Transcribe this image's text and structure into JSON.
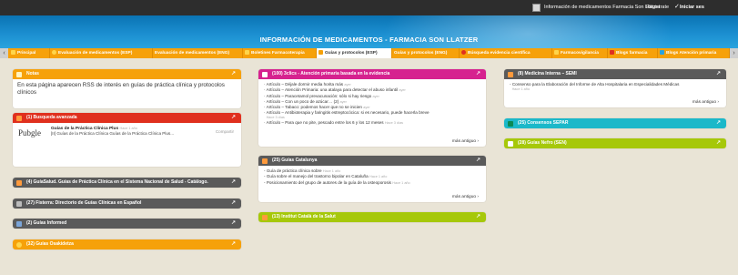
{
  "topbar": {
    "site_name": "Información de medicamentos Farmacia Son Llätzer",
    "register": "Registrate",
    "login": "Iniciar ses"
  },
  "header": {
    "title": "INFORMACIÓN DE MEDICAMENTOS - FARMACIA SON LLATZER"
  },
  "tabs": [
    {
      "label": "Principal",
      "icon_color": "#ffd54a"
    },
    {
      "label": "Evaluación de medicamentos (ESP)",
      "icon_color": "#ffd54a"
    },
    {
      "label": "Evaluación de medicamentos (ENG)",
      "icon_color": ""
    },
    {
      "label": "Boletines Farmacoterapia",
      "icon_color": "#ffd54a"
    },
    {
      "label": "Guías y protocolos (ESP)",
      "icon_color": "#f6a10a"
    },
    {
      "label": "Guías y protocolos (ENG)",
      "icon_color": ""
    },
    {
      "label": "Búsqueda evidencia científica",
      "icon_color": "#e0301e"
    },
    {
      "label": "Farmacovigilancia",
      "icon_color": "#ffd54a"
    },
    {
      "label": "Blogs farmacia",
      "icon_color": "#e0301e"
    },
    {
      "label": "Blogs Atención primaria",
      "icon_color": "#2aa3de"
    }
  ],
  "notes": {
    "title": "Notas",
    "color": "#f6a10a",
    "text": "En esta página aparecen RSS de interés en guías de práctica clínica y protocolos clínicos"
  },
  "busqueda": {
    "title": "(1) Busqueda avanzada",
    "color": "#e0301e",
    "logo": "Pubgle",
    "item_title": "Guías de la Práctica Clínica Plus",
    "item_ago": "Hace 1 año",
    "item_desc": "[II] Guías de la Práctica Clínica Guías de la Práctica Clínica Plus...",
    "compartir": "Compartir"
  },
  "left_widgets": [
    {
      "title": "(4) GuíaSalud. Guías de Práctica Clínica en el Sistema Nacional de Salud - Catálogo.",
      "color": "#5a5a5a"
    },
    {
      "title": "(27) Fisterra: Directorio de Guías Clínicas en Español",
      "color": "#5a5a5a"
    },
    {
      "title": "(2) Guías Informed",
      "color": "#5a5a5a"
    },
    {
      "title": "(32) Guías Osakidetza",
      "color": "#f6a10a"
    }
  ],
  "semfyc": {
    "title": "(100) 3clics - Atención primaria basada en la evidencia",
    "color": "#d6228f",
    "items": [
      {
        "text": "Artículo – Déjale dormir media horita más",
        "ago": "ayer"
      },
      {
        "text": "Artículo – Atención Primaria: una atalaya para detectar el abuso infantil",
        "ago": "ayer"
      },
      {
        "text": "Artículo – Paracetamol prevacunación: sólo si hay riesgo",
        "ago": "ayer"
      },
      {
        "text": "Artículo – Con un poco de azúcar… (2)",
        "ago": "ayer"
      },
      {
        "text": "Artículo – Tabaco: podemos hacer que no se inicien",
        "ago": "ayer"
      },
      {
        "text": "Artículo – Antibioterapia y faringitis estreptocócica: si es necesario, puede hacerla breve",
        "ago": "Hace 3 días"
      },
      {
        "text": "Artículo – Para que no pite, pescado entre los 6 y los 12 meses",
        "ago": "Hace 3 días"
      }
    ],
    "more": "más antiguo"
  },
  "catalunya": {
    "title": "(25) Guías Catalunya",
    "color": "#5a5a5a",
    "items": [
      {
        "text": "Guía de práctica clínica sobre",
        "ago": "Hace 1 año"
      },
      {
        "text": "Guía sobre el manejo del trastorno bipolar en Cataluña",
        "ago": "Hace 1 año"
      },
      {
        "text": "Posicionamiento del grupo de autores de la guía de la osteoporosis",
        "ago": "Hace 1 año"
      }
    ],
    "more": "más antiguo"
  },
  "ics": {
    "title": "(13) Institut Català de la Salut",
    "color": "#a6c80a"
  },
  "semi": {
    "title": "(8) Medicina Interna – SEMI",
    "color": "#5a5a5a",
    "items": [
      {
        "text": "Consenso para la Elaboración del Informe de Alta Hospitalaria en Especialidades Médicas",
        "ago": "Hace 1 año"
      }
    ],
    "more": "más antiguo"
  },
  "separ": {
    "title": "(25) Consensos SEPAR",
    "color": "#1bb8c9"
  },
  "nefro": {
    "title": "(28) Guías Nefro (SEN)",
    "color": "#a6c80a"
  },
  "more_arrow": "›",
  "menu_arrow": "↗"
}
